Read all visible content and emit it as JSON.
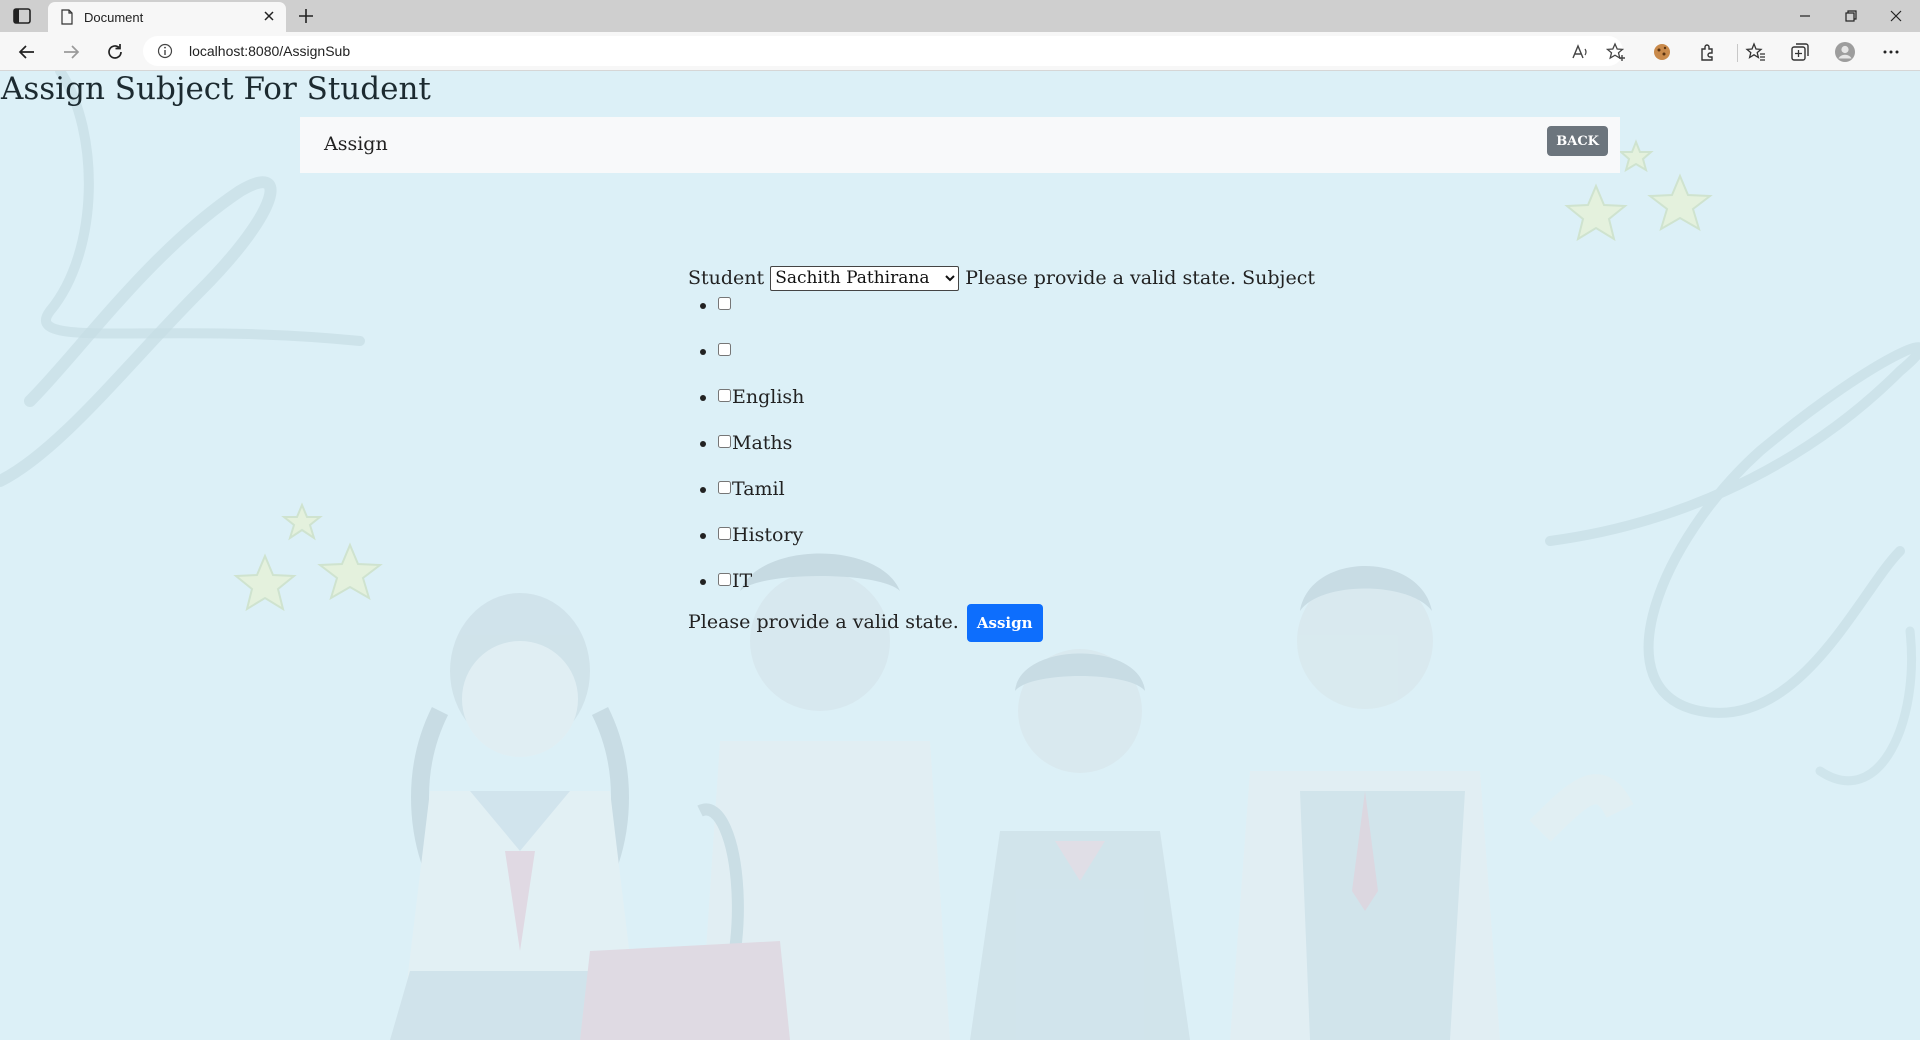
{
  "browser": {
    "tab_title": "Document",
    "url": "localhost:8080/AssignSub"
  },
  "page": {
    "title": "Assign Subject For Student",
    "navbar": {
      "brand": "Assign",
      "back_label": "BACK"
    },
    "form": {
      "student_label": "Student",
      "student_selected": "Sachith Pathirana",
      "student_feedback": "Please provide a valid state.",
      "subject_label": "Subject",
      "subjects": [
        "",
        "",
        "English",
        "Maths",
        "Tamil",
        "History",
        "IT"
      ],
      "submit_feedback": "Please provide a valid state.",
      "submit_label": "Assign"
    }
  },
  "colors": {
    "page_background": "#dcf0f7",
    "navbar_background": "#f8f9fa",
    "back_button": "#6c757d",
    "assign_button": "#0d6efd"
  }
}
